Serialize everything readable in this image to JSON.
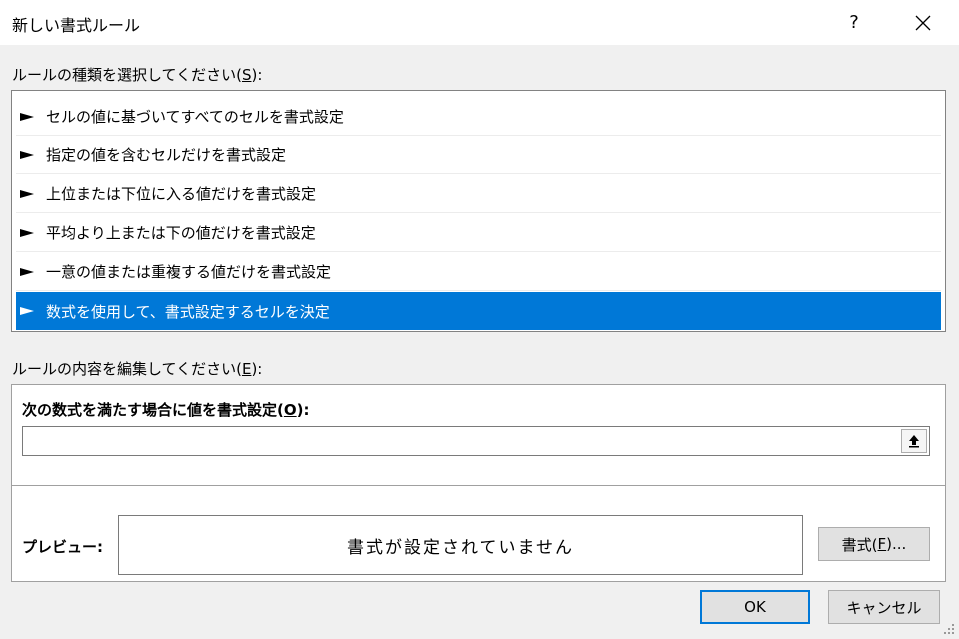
{
  "window": {
    "title": "新しい書式ルール",
    "help_label": "?"
  },
  "rule_type": {
    "label_prefix": "ルールの種類を選択してください(",
    "label_key": "S",
    "label_suffix": "):",
    "items": [
      {
        "label": "セルの値に基づいてすべてのセルを書式設定"
      },
      {
        "label": "指定の値を含むセルだけを書式設定"
      },
      {
        "label": "上位または下位に入る値だけを書式設定"
      },
      {
        "label": "平均より上または下の値だけを書式設定"
      },
      {
        "label": "一意の値または重複する値だけを書式設定"
      },
      {
        "label": "数式を使用して、書式設定するセルを決定"
      }
    ],
    "selected_index": 5
  },
  "rule_edit": {
    "label_prefix": "ルールの内容を編集してください(",
    "label_key": "E",
    "label_suffix": "):",
    "formula_label_prefix": "次の数式を満たす場合に値を書式設定(",
    "formula_label_key": "O",
    "formula_label_suffix": "):",
    "formula_value": "",
    "preview_label": "プレビュー:",
    "preview_text": "書式が設定されていません",
    "format_button_prefix": "書式(",
    "format_button_key": "F",
    "format_button_suffix": ")..."
  },
  "buttons": {
    "ok": "OK",
    "cancel": "キャンセル"
  },
  "colors": {
    "selection": "#0078d7",
    "default_button_border": "#0078d7"
  }
}
